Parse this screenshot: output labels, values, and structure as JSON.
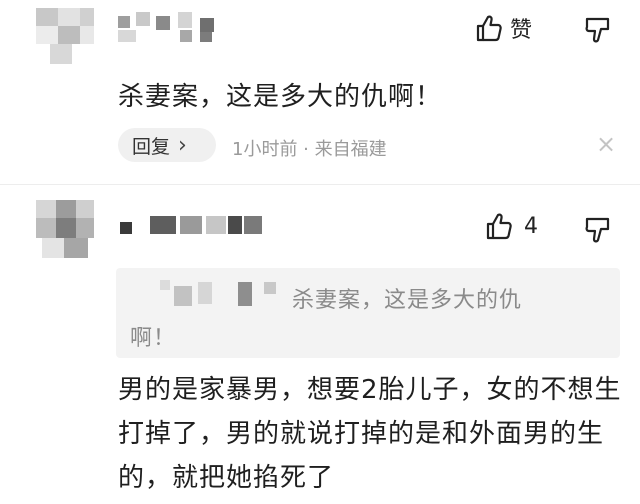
{
  "comment1": {
    "like_label": "赞",
    "text": "杀妻案，这是多大的仇啊！",
    "reply_label": "回复",
    "reply_chevron": "›",
    "meta": "1小时前 · 来自福建",
    "close_glyph": "×"
  },
  "comment2": {
    "like_count": "4",
    "quote_line1": "杀妻案，这是多大的仇",
    "quote_line2": "啊！",
    "body": "男的是家暴男，想要2胎儿子，女的不想生打掉了，男的就说打掉的是和外面男的生的，就把她掐死了"
  },
  "icons": {
    "like": "thumbs-up-icon",
    "dislike": "thumbs-down-icon",
    "close": "close-icon"
  }
}
